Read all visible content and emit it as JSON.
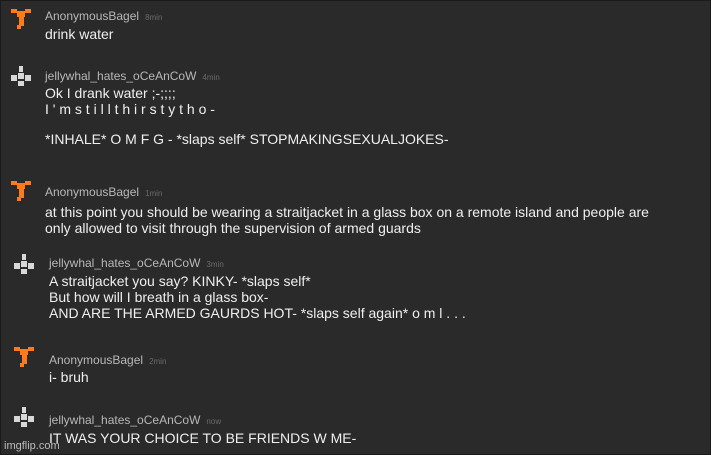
{
  "colors": {
    "background": "#2a2a2a",
    "username": "#b8b8b8",
    "timestamp": "#6a6a6a",
    "body_text": "#efefef",
    "avatar_orange": "#ff7a1a",
    "avatar_white": "#d8d8d8"
  },
  "comments": [
    {
      "avatar_icon": "orange-pixel-figure-icon",
      "username": "AnonymousBagel",
      "time": "8min",
      "lines": [
        "drink water"
      ]
    },
    {
      "avatar_icon": "white-pixel-figure-icon",
      "username": "jellywhal_hates_oCeAnCoW",
      "time": "4min",
      "lines": [
        "Ok I drank water ;-;;;;",
        "I ' m s t i l l t h i r s t y t h o -",
        "",
        "*INHALE* O M F G - *slaps self* STOPMAKINGSEXUALJOKES-"
      ]
    },
    {
      "avatar_icon": "orange-pixel-figure-icon",
      "username": "AnonymousBagel",
      "time": "1min",
      "lines": [
        "at this point you should be wearing a straitjacket in a glass box on a remote island and people are",
        "only allowed to visit through the supervision of armed guards"
      ]
    },
    {
      "avatar_icon": "white-pixel-figure-icon",
      "username": "jellywhal_hates_oCeAnCoW",
      "time": "3min",
      "lines": [
        "A straitjacket you say? KINKY- *slaps self*",
        "But how will I breath in a glass box-",
        "AND ARE THE ARMED GAURDS HOT- *slaps self again* o m l . . ."
      ]
    },
    {
      "avatar_icon": "orange-pixel-figure-icon",
      "username": "AnonymousBagel",
      "time": "2min",
      "lines": [
        "i- bruh"
      ]
    },
    {
      "avatar_icon": "white-pixel-figure-icon",
      "username": "jellywhal_hates_oCeAnCoW",
      "time": "now",
      "lines": [
        "IT WAS YOUR CHOICE TO BE FRIENDS W ME-"
      ]
    }
  ],
  "watermark": "imgflip.com"
}
